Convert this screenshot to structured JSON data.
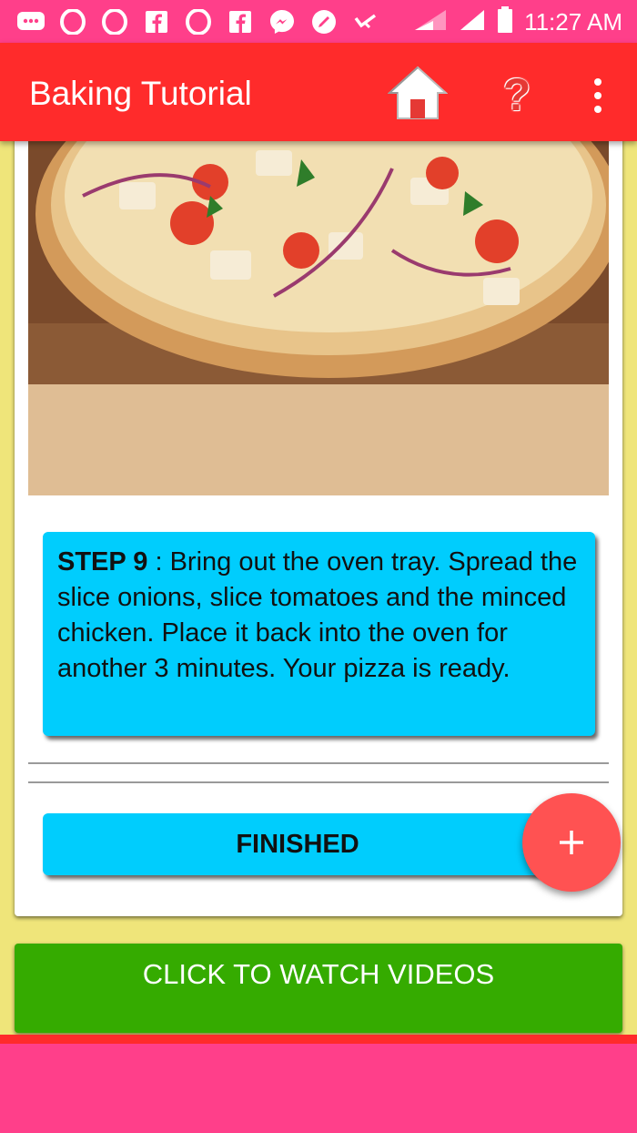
{
  "status_bar": {
    "time": "11:27 AM",
    "left_icons": [
      "chat-icon",
      "opera-icon",
      "opera-icon",
      "facebook-icon",
      "opera-icon",
      "facebook-icon",
      "messenger-icon",
      "brush-icon",
      "check-icon"
    ],
    "right_icons": [
      "signal-icon",
      "signal-icon",
      "battery-icon"
    ]
  },
  "app_bar": {
    "title": "Baking Tutorial",
    "home_icon": "home-icon",
    "help_icon": "help-icon",
    "help_glyph": "?",
    "more_icon": "more-vert-icon"
  },
  "card": {
    "image": "pizza-image",
    "step": {
      "label": "STEP 9",
      "text": " : Bring out the oven tray. Spread the slice onions, slice tomatoes and the minced chicken. Place it back into the oven for another 3 minutes. Your pizza is ready."
    },
    "finished_label": "FINISHED",
    "fab_icon": "plus-icon"
  },
  "watch_videos_label": "CLICK TO WATCH VIDEOS",
  "colors": {
    "status_bar": "#ff3f8a",
    "app_bar": "#ff2b2b",
    "background": "#efe57a",
    "step_box": "#00cdfd",
    "fab": "#ff5252",
    "watch_button": "#35ab00"
  }
}
